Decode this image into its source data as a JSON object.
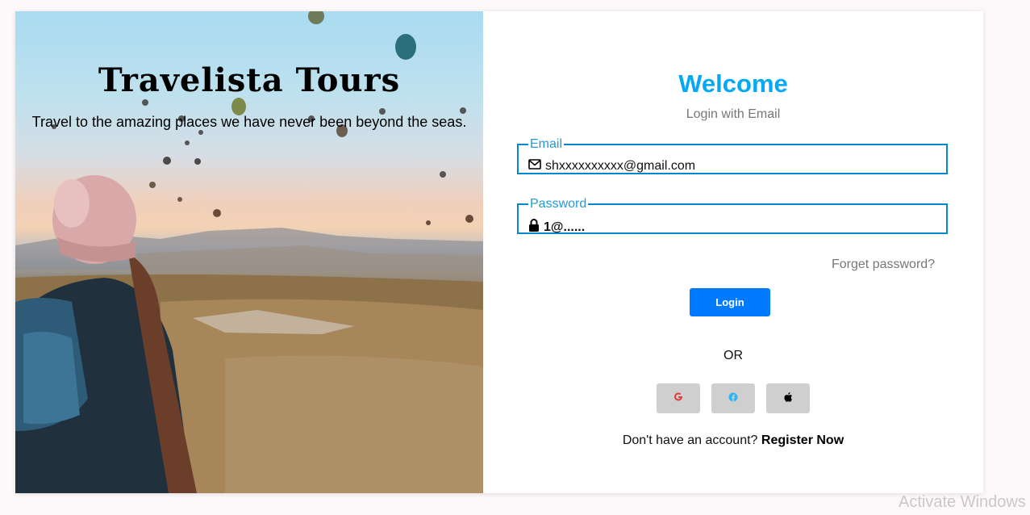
{
  "hero": {
    "title": "Travelista Tours",
    "subtitle": "Travel to the amazing places we have never been beyond the seas."
  },
  "login": {
    "title": "Welcome",
    "subtitle": "Login with Email",
    "email": {
      "label": "Email",
      "value": "shxxxxxxxxxx@gmail.com",
      "icon": "envelope-icon"
    },
    "password": {
      "label": "Password",
      "value": "1@......",
      "icon": "lock-icon"
    },
    "forgot_label": "Forget password?",
    "login_button": "Login",
    "or_label": "OR",
    "social": [
      {
        "name": "google",
        "icon": "google-icon",
        "color": "#e53935"
      },
      {
        "name": "facebook",
        "icon": "facebook-icon",
        "color": "#29b6f6"
      },
      {
        "name": "apple",
        "icon": "apple-icon",
        "color": "#000000"
      }
    ],
    "register_prompt": "Don't have an account?",
    "register_link": "Register Now"
  },
  "colors": {
    "accent": "#03a9f4",
    "field_border": "#0288d1",
    "button": "#007bff"
  },
  "os_overlay": {
    "watermark": "Activate Windows"
  }
}
